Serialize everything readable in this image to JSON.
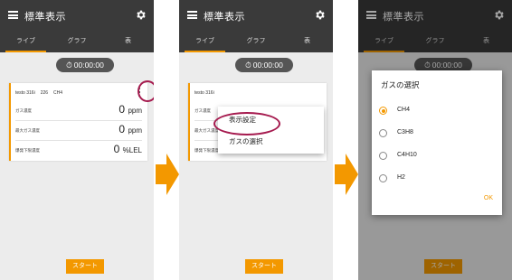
{
  "appbar": {
    "title": "標準表示"
  },
  "tabs": [
    "ライブ",
    "グラフ",
    "表"
  ],
  "timer": "00:00:00",
  "card": {
    "device": "testo 316i",
    "number": "226",
    "gas": "CH4",
    "device_short": "testo 316i",
    "rows": [
      {
        "label": "ガス濃度",
        "value": "0",
        "unit": "ppm"
      },
      {
        "label": "最大ガス濃度",
        "value": "0",
        "unit": "ppm"
      },
      {
        "label": "爆発下限濃度",
        "value": "0",
        "unit": "%LEL"
      }
    ],
    "rows_short": [
      "ガス濃度",
      "最大ガス濃度",
      "爆発下限濃度"
    ]
  },
  "start_label": "スタート",
  "popup_menu": {
    "items": [
      "表示設定",
      "ガスの選択"
    ]
  },
  "gas_dialog": {
    "title": "ガスの選択",
    "options": [
      "CH4",
      "C3H8",
      "C4H10",
      "H2"
    ],
    "selected": "CH4",
    "ok_label": "OK"
  },
  "colors": {
    "accent": "#f39800",
    "appbar": "#3a3a3a",
    "highlight": "#a51a4e"
  }
}
